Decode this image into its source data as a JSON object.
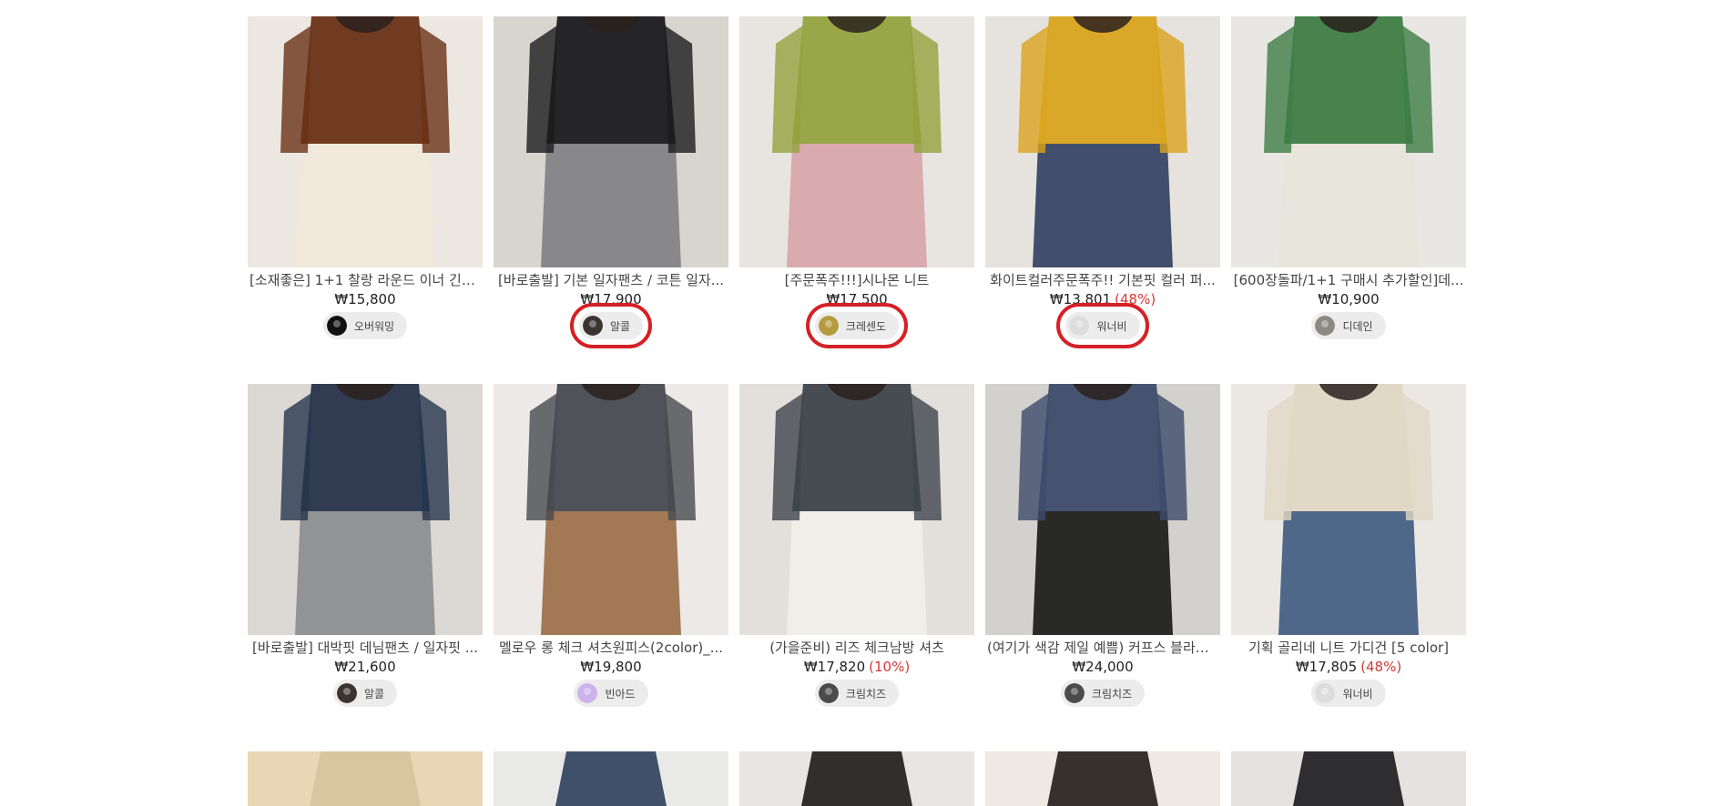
{
  "colors": {
    "highlight": "#d42026",
    "discount": "#d33a3a",
    "chip_bg": "#ececec"
  },
  "products": [
    {
      "title": "[소재좋은] 1+1 찰랑 라운드 이너 긴팔...",
      "price": "₩15,800",
      "discount": "",
      "store": "오버워밍",
      "avatar_icon": "overwarming-avatar-icon",
      "avatar_color": "#111111",
      "image_icon": "brown-knit-top-photo",
      "colors": [
        "#ece7e1",
        "#6a3216",
        "#efe8da"
      ],
      "highlight": false
    },
    {
      "title": "[바로출발] 기본 일자팬츠 / 코튼 일자...",
      "price": "₩17,900",
      "discount": "",
      "store": "알콜",
      "avatar_icon": "alcol-avatar-icon",
      "avatar_color": "#3a3330",
      "image_icon": "black-pants-photo",
      "colors": [
        "#d8d5cf",
        "#1b1b1d",
        "#7f8083"
      ],
      "highlight": true
    },
    {
      "title": "[주문폭주!!!]시나몬 니트",
      "price": "₩17,500",
      "discount": "",
      "store": "크레센도",
      "avatar_icon": "crescendo-avatar-icon",
      "avatar_color": "#b59b3f",
      "image_icon": "green-knit-photo",
      "colors": [
        "#e8e4df",
        "#94a33f",
        "#d7a3a8"
      ],
      "highlight": true
    },
    {
      "title": "화이트컬러주문폭주!! 기본핏 컬러 퍼...",
      "price": "₩13,801",
      "discount": "(48%)",
      "store": "워너비",
      "avatar_icon": "wannabe-avatar-icon",
      "avatar_color": "#dddddd",
      "image_icon": "yellow-shirt-photo",
      "colors": [
        "#e6e2dd",
        "#d9a41e",
        "#2f3f5f"
      ],
      "highlight": true
    },
    {
      "title": "[600장돌파/1+1 구매시 추가할인]데...",
      "price": "₩10,900",
      "discount": "",
      "store": "디데인",
      "avatar_icon": "didein-avatar-icon",
      "avatar_color": "#8c8a80",
      "image_icon": "green-tee-photo",
      "colors": [
        "#e9e7e3",
        "#3f7d46",
        "#e8e4da"
      ],
      "highlight": false
    },
    {
      "title": "[바로출발] 대박핏 데님팬츠 / 일자핏 ...",
      "price": "₩21,600",
      "discount": "",
      "store": "알콜",
      "avatar_icon": "alcol-avatar-icon",
      "avatar_color": "#3a3330",
      "image_icon": "denim-pants-photo",
      "colors": [
        "#dcd9d4",
        "#27344c",
        "#8a8b8e"
      ],
      "highlight": false
    },
    {
      "title": "멜로우 롱 체크 셔츠원피스(2color)_...",
      "price": "₩19,800",
      "discount": "",
      "store": "빈아드",
      "avatar_icon": "vinad-avatar-icon",
      "avatar_color": "#cbb4ec",
      "image_icon": "check-dress-photo",
      "colors": [
        "#ece9e6",
        "#474a50",
        "#9a6d44"
      ],
      "highlight": false
    },
    {
      "title": "(가을준비) 리즈 체크남방 셔츠",
      "price": "₩17,820",
      "discount": "(10%)",
      "store": "크림치즈",
      "avatar_icon": "creamcheese-avatar-icon",
      "avatar_color": "#4b4b4b",
      "image_icon": "check-shirt-photo",
      "colors": [
        "#e3dfda",
        "#3e434c",
        "#f1efea"
      ],
      "highlight": false
    },
    {
      "title": "(여기가 색감 제일 예쁨) 커프스 블라우...",
      "price": "₩24,000",
      "discount": "",
      "store": "크림치즈",
      "avatar_icon": "creamcheese-avatar-icon",
      "avatar_color": "#4b4b4b",
      "image_icon": "navy-blouse-photo",
      "colors": [
        "#d3d1ce",
        "#3d4b6a",
        "#161616"
      ],
      "highlight": false
    },
    {
      "title": "기획 골리네 니트 가디건 [5 color]",
      "price": "₩17,805",
      "discount": "(48%)",
      "store": "워너비",
      "avatar_icon": "wannabe-avatar-icon",
      "avatar_color": "#dddddd",
      "image_icon": "beige-cardigan-photo",
      "colors": [
        "#ebe8e4",
        "#e1d7c4",
        "#3e5a7f"
      ],
      "highlight": false
    }
  ],
  "partial_row": [
    {
      "image_icon": "beige-fabric-photo",
      "colors": [
        "#e9d6b4",
        "#d8c39e"
      ]
    },
    {
      "image_icon": "denim-top-photo",
      "colors": [
        "#e9e9e7",
        "#2e3f5c"
      ]
    },
    {
      "image_icon": "hair-closeup-photo",
      "colors": [
        "#e8e6e4",
        "#1d1a18"
      ]
    },
    {
      "image_icon": "dark-hair-photo",
      "colors": [
        "#efe9e3",
        "#221d1a"
      ]
    },
    {
      "image_icon": "black-top-photo",
      "colors": [
        "#e5e2df",
        "#1a1a1c"
      ]
    }
  ]
}
